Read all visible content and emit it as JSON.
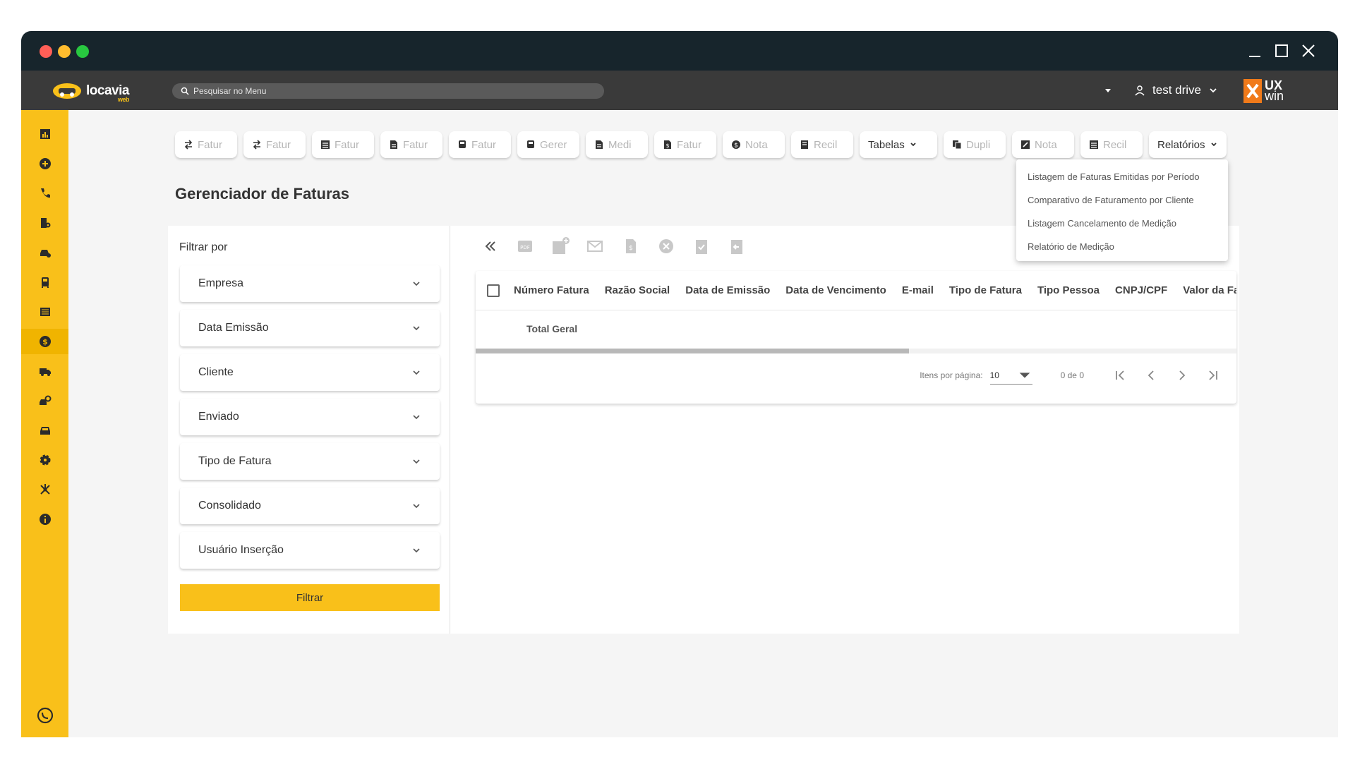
{
  "colors": {
    "accent": "#f9c01a",
    "titlebar": "#17252c",
    "appbar": "#3a3a3a",
    "brand_orange": "#f07a1a"
  },
  "window": {
    "controls": [
      "minimize-icon",
      "maximize-icon",
      "close-icon"
    ]
  },
  "brand": {
    "logo_text": "locavia",
    "logo_sub": "web"
  },
  "search": {
    "placeholder": "Pesquisar no Menu"
  },
  "user": {
    "name": "test drive"
  },
  "partner": {
    "line1": "UX",
    "line2": "win"
  },
  "sidebar": {
    "items": [
      {
        "icon": "chart-icon"
      },
      {
        "icon": "plus-circle-icon"
      },
      {
        "icon": "phone-icon"
      },
      {
        "icon": "building-icon"
      },
      {
        "icon": "car-key-icon"
      },
      {
        "icon": "bus-icon"
      },
      {
        "icon": "fleet-icon"
      },
      {
        "icon": "dollar-icon",
        "active": true
      },
      {
        "icon": "truck-icon"
      },
      {
        "icon": "car-search-icon"
      },
      {
        "icon": "car-icon"
      },
      {
        "icon": "gear-icon"
      },
      {
        "icon": "hub-icon"
      },
      {
        "icon": "info-icon"
      }
    ],
    "bottom_icon": "whatsapp-icon"
  },
  "toolbar": {
    "buttons": [
      {
        "label": "Fatur",
        "icon": "exchange-icon"
      },
      {
        "label": "Fatur",
        "icon": "exchange-icon"
      },
      {
        "label": "Fatur",
        "icon": "list-icon"
      },
      {
        "label": "Fatur",
        "icon": "doc-icon"
      },
      {
        "label": "Fatur",
        "icon": "bus-icon"
      },
      {
        "label": "Gerer",
        "icon": "bus-icon"
      },
      {
        "label": "Medi",
        "icon": "doc-icon"
      },
      {
        "label": "Fatur",
        "icon": "doc-dollar-icon"
      },
      {
        "label": "Nota",
        "icon": "dollar-icon"
      },
      {
        "label": "Recil",
        "icon": "receipt-icon"
      }
    ],
    "tabelas_label": "Tabelas",
    "buttons2": [
      {
        "label": "Dupli",
        "icon": "copy-icon"
      },
      {
        "label": "Nota",
        "icon": "edit-icon"
      },
      {
        "label": "Recil",
        "icon": "list-icon"
      }
    ],
    "relatorios_label": "Relatórios"
  },
  "page": {
    "title": "Gerenciador de Faturas"
  },
  "filters": {
    "title": "Filtrar por",
    "fields": [
      "Empresa",
      "Data Emissão",
      "Cliente",
      "Enviado",
      "Tipo de Fatura",
      "Consolidado",
      "Usuário Inserção"
    ],
    "button_label": "Filtrar"
  },
  "actions": [
    "collapse-left-icon",
    "pdf-icon",
    "calendar-add-icon",
    "email-send-icon",
    "doc-dollar-icon",
    "cancel-icon",
    "clipboard-check-icon",
    "clipboard-back-icon"
  ],
  "table": {
    "columns": [
      "Número Fatura",
      "Razão Social",
      "Data de Emissão",
      "Data de Vencimento",
      "E-mail",
      "Tipo de Fatura",
      "Tipo Pessoa",
      "CNPJ/CPF",
      "Valor da Fatura"
    ],
    "total_label": "Total Geral",
    "scroll_fraction": 0.57
  },
  "pagination": {
    "per_page_label": "Itens por página:",
    "per_page_value": "10",
    "range": "0 de 0"
  },
  "relatorios_menu": {
    "items": [
      "Listagem de Faturas Emitidas por Período",
      "Comparativo de Faturamento por Cliente",
      "Listagem Cancelamento de Medição",
      "Relatório de Medição"
    ]
  }
}
